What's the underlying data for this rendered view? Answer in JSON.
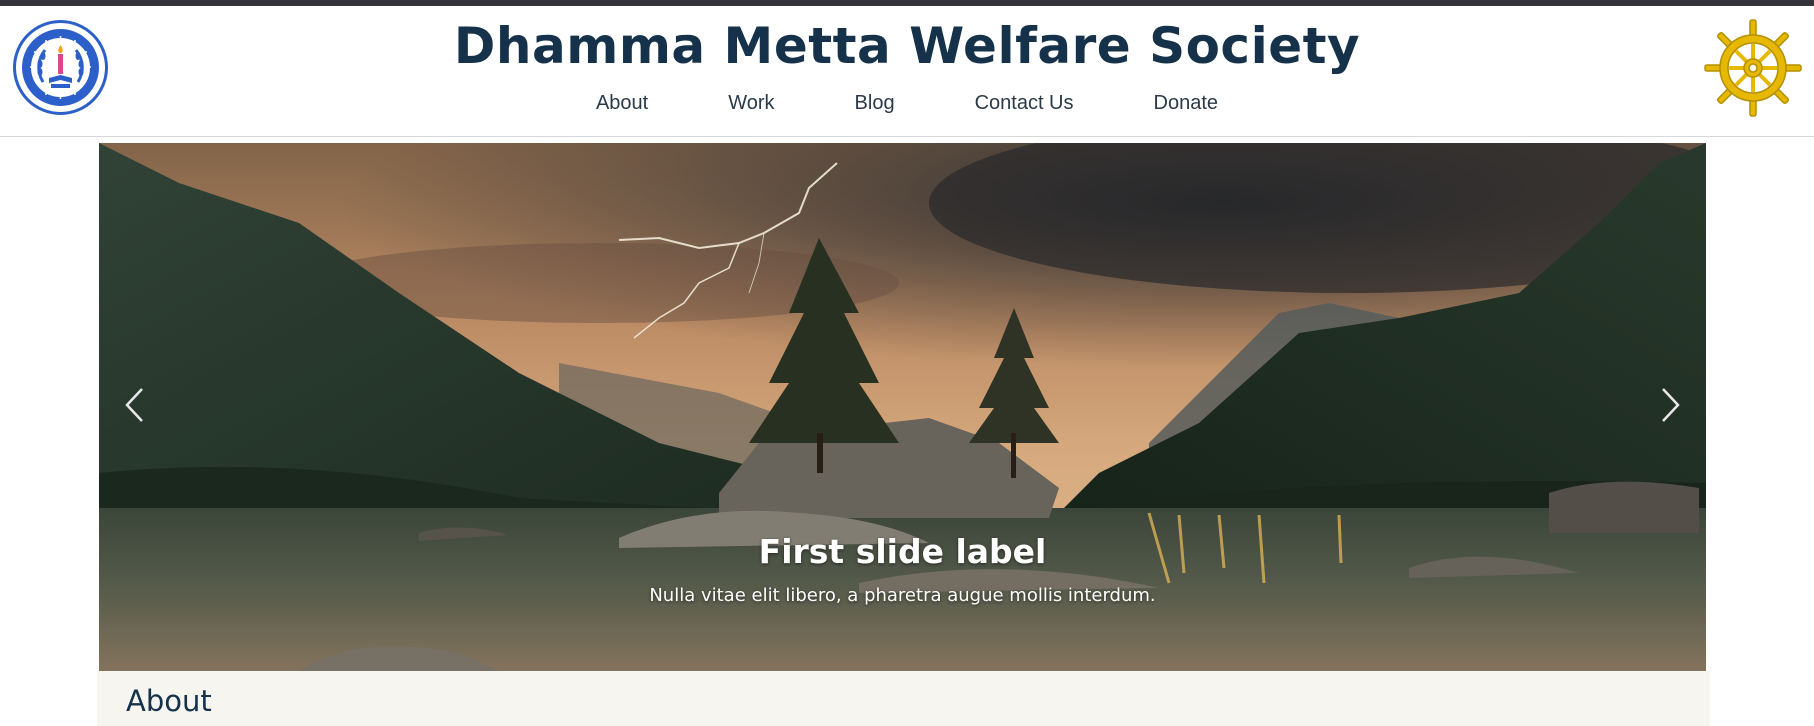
{
  "site": {
    "title": "Dhamma Metta Welfare Society",
    "left_logo_icon": "society-emblem-icon",
    "right_logo_icon": "dharma-wheel-icon",
    "logo_ring_color": "#2c5fc9",
    "wheel_color": "#e6b800"
  },
  "nav": {
    "items": [
      {
        "label": "About"
      },
      {
        "label": "Work"
      },
      {
        "label": "Blog"
      },
      {
        "label": "Contact Us"
      },
      {
        "label": "Donate"
      }
    ]
  },
  "carousel": {
    "prev_icon": "chevron-left-icon",
    "next_icon": "chevron-right-icon",
    "slide": {
      "label": "First slide label",
      "text": "Nulla vitae elit libero, a pharetra augue mollis interdum."
    }
  },
  "about": {
    "heading": "About"
  },
  "colors": {
    "heading": "#15324a",
    "nav_text": "#2b3a48",
    "about_bg": "#f7f5f0"
  }
}
